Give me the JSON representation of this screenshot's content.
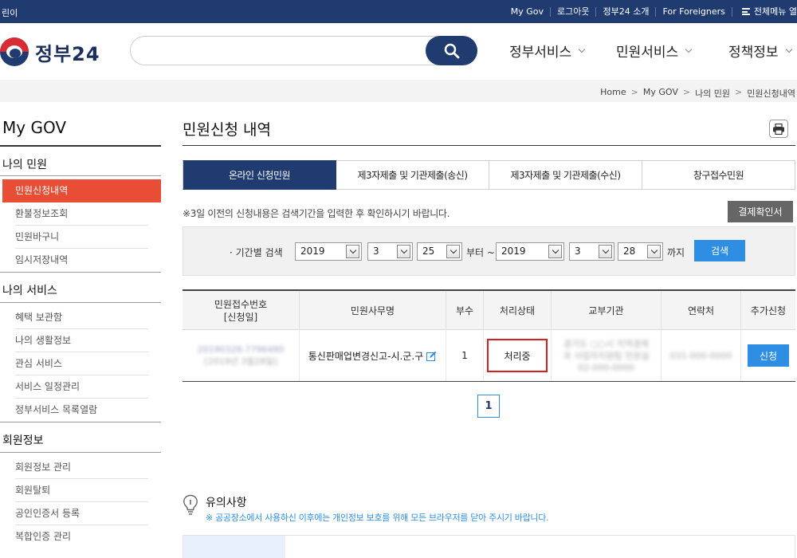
{
  "topbar": {
    "left_text": "린이",
    "links": [
      "My Gov",
      "로그아웃",
      "정부24 소개",
      "For Foreigners"
    ],
    "all_menu": "전체메뉴 열"
  },
  "header": {
    "logo_text": "정부24",
    "search_placeholder": "",
    "nav": [
      "정부서비스",
      "민원서비스",
      "정책정보"
    ]
  },
  "breadcrumb": [
    "Home",
    "My GOV",
    "나의 민원",
    "민원신청내역"
  ],
  "sidebar": {
    "title": "My GOV",
    "groups": [
      {
        "label": "나의 민원",
        "items": [
          "민원신청내역",
          "환불정보조회",
          "민원바구니",
          "임시저장내역"
        ]
      },
      {
        "label": "나의 서비스",
        "items": [
          "혜택 보관함",
          "나의 생활정보",
          "관심 서비스",
          "서비스 일정관리",
          "정부서비스 목록열람"
        ]
      },
      {
        "label": "회원정보",
        "items": [
          "회원정보 관리",
          "회원탈퇴",
          "공인인증서 등록",
          "복합인증 관리"
        ]
      }
    ],
    "active_item": "민원신청내역"
  },
  "main": {
    "title": "민원신청 내역",
    "tabs": [
      "온라인 신청민원",
      "제3자제출 및 기관제출(송신)",
      "제3자제출 및 기관제출(수신)",
      "창구접수민원"
    ],
    "notice": "※3일 이전의 신청내용은 검색기간을 입력한 후 확인하시기 바랍니다.",
    "receipt_button": "결제확인서",
    "filter": {
      "label": "· 기간별 검색",
      "from_year": "2019",
      "from_month": "3",
      "from_day": "25",
      "from_suffix": "부터 ~",
      "to_year": "2019",
      "to_month": "3",
      "to_day": "28",
      "to_suffix": "까지",
      "search_button": "검색"
    },
    "table": {
      "headers": [
        "민원접수번호\n[신청일]",
        "민원사무명",
        "부수",
        "처리상태",
        "교부기관",
        "연락처",
        "추가신청"
      ],
      "rows": [
        {
          "receipt_no": "20190328-7796480",
          "receipt_date": "[2019년 3월28일]",
          "service_name": "통신판매업변경신고-시.군.구",
          "copies": "1",
          "status": "처리중",
          "agency": "경기도 ○○시 지역경제과 사업자지원팀 민원실 02-000-0000",
          "contact": "031-000-0000",
          "action": "신청"
        }
      ]
    },
    "pagination": [
      "1"
    ],
    "caution": {
      "title": "유의사항",
      "text": "※ 공공장소에서 사용하신 이후에는 개인정보 보호를 위해 모든 브라우저를 닫아 주시기 바랍니다."
    }
  },
  "colors": {
    "navy": "#1f3b6f",
    "active_red": "#e84e36",
    "blue_button": "#2d8ee3",
    "status_border": "#d62020"
  }
}
